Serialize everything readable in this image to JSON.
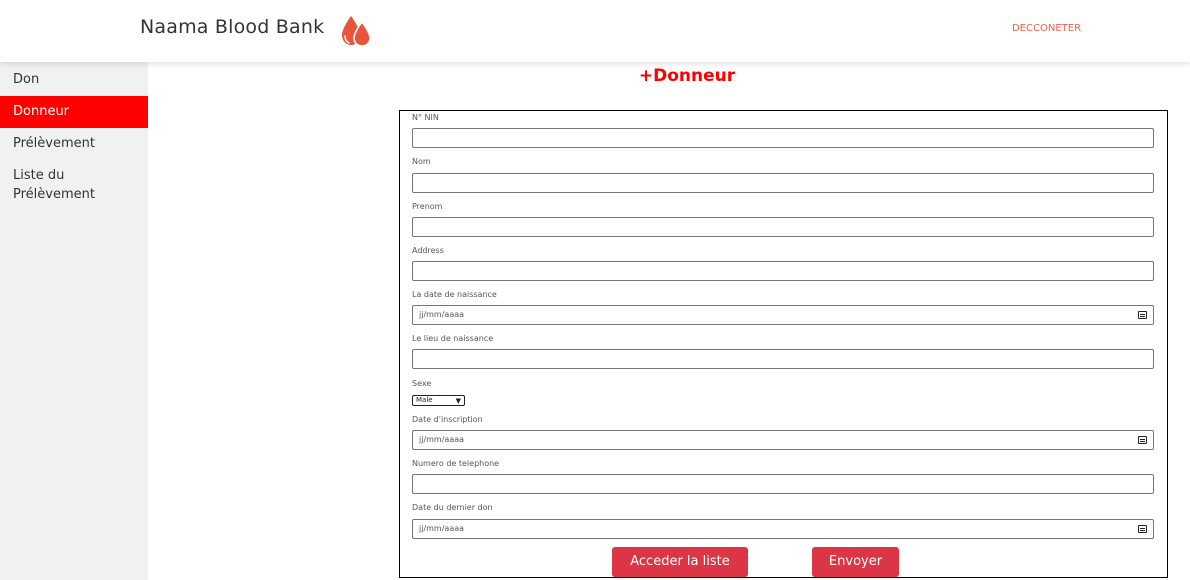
{
  "header": {
    "brand": "Naama Blood Bank",
    "logo_icon": "blood-drops-icon",
    "logout_label": "DECCONETER"
  },
  "sidebar": {
    "items": [
      {
        "label": "Don"
      },
      {
        "label": "Donneur"
      },
      {
        "label": "Prélèvement"
      },
      {
        "label": "Liste du Prélèvement"
      }
    ],
    "active_index": 1
  },
  "main": {
    "title": "+Donneur",
    "form": {
      "nin_label": "N° NIN",
      "nom_label": "Nom",
      "prenom_label": "Prenom",
      "address_label": "Address",
      "date_naissance_label": "La date de naissance",
      "date_naissance_placeholder": "jj/mm/aaaa",
      "lieu_naissance_label": "Le lieu de naissance",
      "sexe_label": "Sexe",
      "sexe_value": "Male",
      "date_inscription_label": "Date d'inscription",
      "date_inscription_placeholder": "jj/mm/aaaa",
      "telephone_label": "Numero de telephone",
      "dernier_don_label": "Date du dernier don",
      "dernier_don_placeholder": "jj/mm/aaaa"
    },
    "buttons": {
      "list_label": "Acceder la liste",
      "send_label": "Envoyer"
    }
  },
  "colors": {
    "accent": "#ff0000",
    "button": "#dc3545",
    "logout": "#e8604c",
    "sidebar_bg": "#f1f1f1"
  }
}
